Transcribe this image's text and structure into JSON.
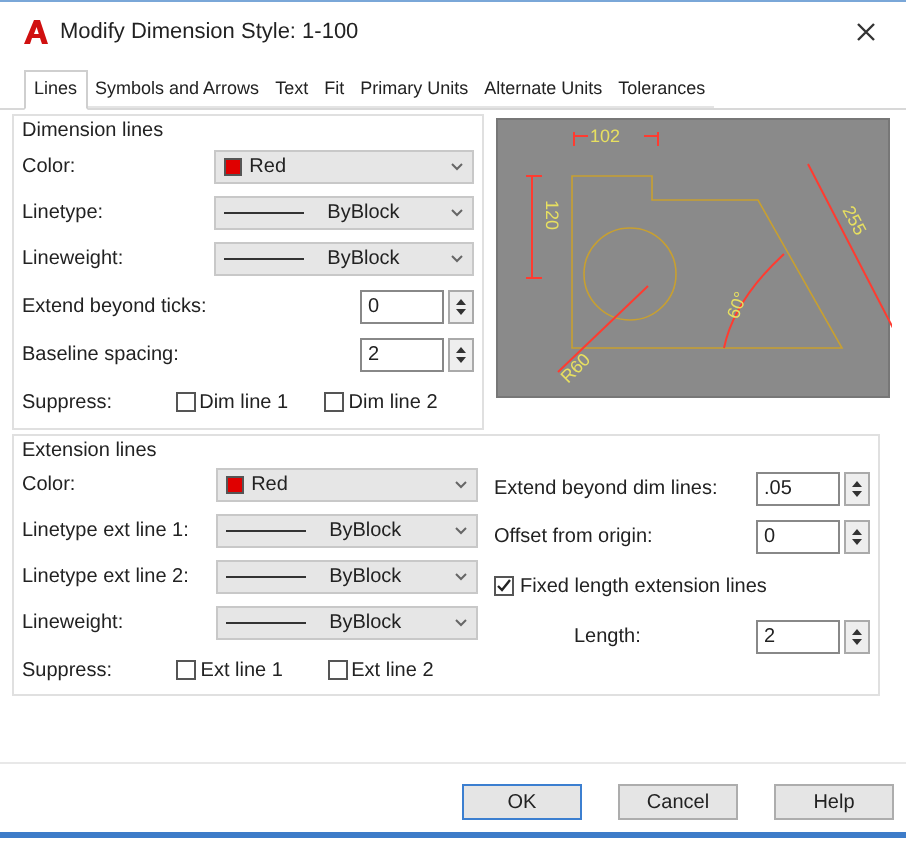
{
  "window": {
    "title": "Modify Dimension Style: 1-100"
  },
  "tabs": [
    {
      "label": "Lines",
      "selected": true
    },
    {
      "label": "Symbols and Arrows",
      "selected": false
    },
    {
      "label": "Text",
      "selected": false
    },
    {
      "label": "Fit",
      "selected": false
    },
    {
      "label": "Primary Units",
      "selected": false
    },
    {
      "label": "Alternate Units",
      "selected": false
    },
    {
      "label": "Tolerances",
      "selected": false
    }
  ],
  "dimension_lines": {
    "title": "Dimension lines",
    "rows": [
      {
        "kind": "color",
        "label": "Color:",
        "value": "Red",
        "color": "#e00000"
      },
      {
        "kind": "linetype",
        "label": "Linetype:",
        "value": "ByBlock"
      },
      {
        "kind": "linetype",
        "label": "Lineweight:",
        "value": "ByBlock"
      },
      {
        "kind": "spinner",
        "label": "Extend beyond ticks:",
        "value": "0"
      },
      {
        "kind": "spinner",
        "label": "Baseline spacing:",
        "value": "2"
      },
      {
        "kind": "suppress",
        "label": "Suppress:",
        "options": [
          {
            "label": "Dim line 1",
            "checked": false
          },
          {
            "label": "Dim line 2",
            "checked": false
          }
        ]
      }
    ]
  },
  "preview": {
    "labels": [
      "102",
      "120",
      "R60",
      "60°",
      "255"
    ]
  },
  "extension_lines": {
    "title": "Extension lines",
    "rows": [
      {
        "kind": "color",
        "label": "Color:",
        "value": "Red",
        "color": "#e00000"
      },
      {
        "kind": "linetype",
        "label": "Linetype ext line 1:",
        "value": "ByBlock"
      },
      {
        "kind": "linetype",
        "label": "Linetype ext line 2:",
        "value": "ByBlock"
      },
      {
        "kind": "linetype",
        "label": "Lineweight:",
        "value": "ByBlock"
      },
      {
        "kind": "suppress",
        "label": "Suppress:",
        "options": [
          {
            "label": "Ext line 1",
            "checked": false
          },
          {
            "label": "Ext line 2",
            "checked": false
          }
        ]
      }
    ],
    "side_rows": [
      {
        "kind": "spinner",
        "label": "Extend beyond dim lines:",
        "value": ".05"
      },
      {
        "kind": "spinner",
        "label": "Offset from origin:",
        "value": "0"
      },
      {
        "kind": "checkbox",
        "label": "Fixed length extension lines",
        "checked": true
      },
      {
        "kind": "spinner",
        "label": "Length:",
        "value": "2",
        "indent": true
      }
    ]
  },
  "buttons": [
    "OK",
    "Cancel",
    "Help"
  ]
}
